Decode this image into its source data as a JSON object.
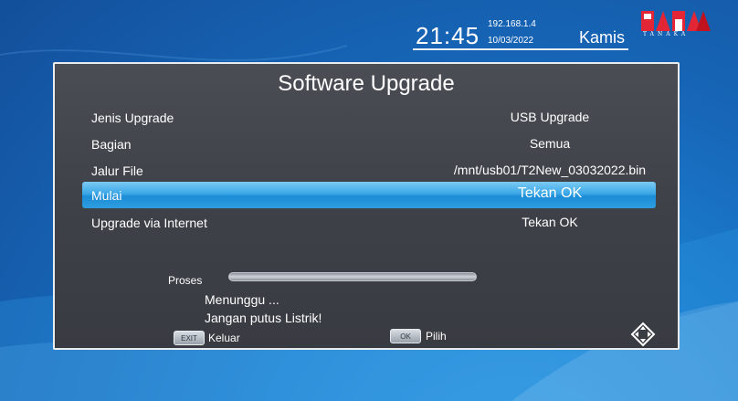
{
  "status_bar": {
    "time": "21:45",
    "ip_address": "192.168.1.4",
    "date": "10/03/2022",
    "day": "Kamis",
    "logo_text": "TANAKA"
  },
  "dialog": {
    "title": "Software Upgrade",
    "rows": [
      {
        "label": "Jenis Upgrade",
        "value": "USB Upgrade",
        "selected": false
      },
      {
        "label": "Bagian",
        "value": "Semua",
        "selected": false
      },
      {
        "label": "Jalur File",
        "value": "/mnt/usb01/T2New_03032022.bin",
        "selected": false
      },
      {
        "label": "Mulai",
        "value": "Tekan OK",
        "selected": true
      },
      {
        "label": "Upgrade via Internet",
        "value": "Tekan OK",
        "selected": false
      }
    ],
    "progress": {
      "label": "Proses",
      "value_percent": 0
    },
    "messages": {
      "line1": "Menunggu ...",
      "line2": "Jangan putus Listrik!"
    },
    "footer": {
      "exit_key": "EXIT",
      "exit_label": "Keluar",
      "ok_key": "OK",
      "ok_label": "Pilih",
      "nav_icon": "navigate-arrows-icon"
    }
  },
  "colors": {
    "background": "#1766b8",
    "dialog_bg": "#42444c",
    "selection": "#2f9ee0",
    "text": "#ffffff"
  }
}
